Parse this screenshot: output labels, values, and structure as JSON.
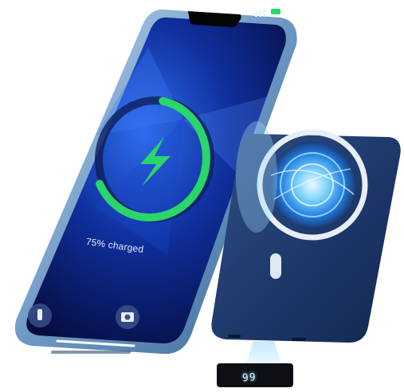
{
  "phone": {
    "charge_label": "75% charged",
    "charge_level": 0.75,
    "screen_accent": "#2ad56a"
  },
  "power_bank": {
    "display_value": "99",
    "body_color": "#1e3a6e",
    "ring_color": "#e8eef6"
  },
  "icons": [
    "flashlight-icon",
    "camera-icon",
    "lightning-bolt-icon",
    "magsafe-ring-icon"
  ]
}
